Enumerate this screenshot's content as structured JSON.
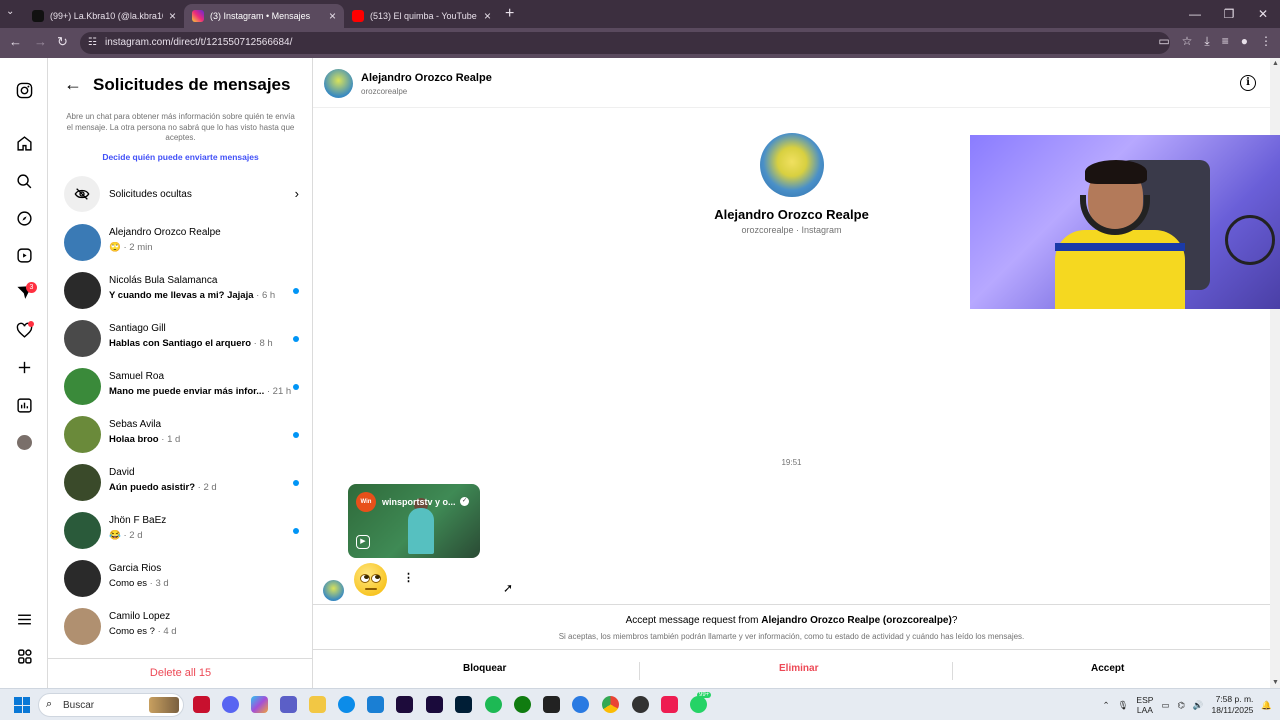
{
  "browser": {
    "tabs": [
      {
        "title": "(99+) La.Kbra10 (@la.kbra10) | T",
        "icon_color": "#111111"
      },
      {
        "title": "(3) Instagram • Mensajes",
        "icon_color": "#e1306c"
      },
      {
        "title": "(513) El quimba - YouTube",
        "icon_color": "#ff0000"
      }
    ],
    "url": "instagram.com/direct/t/121550712566684/"
  },
  "nav": {
    "messages_badge": "3"
  },
  "requests": {
    "title": "Solicitudes de mensajes",
    "info": "Abre un chat para obtener más información sobre quién te envía el mensaje. La otra persona no sabrá que lo has visto hasta que aceptes.",
    "link": "Decide quién puede enviarte mensajes",
    "hidden_label": "Solicitudes ocultas",
    "threads": [
      {
        "name": "Alejandro Orozco Realpe",
        "message": "🙄",
        "time": " · 2 min",
        "unread": false,
        "color": "#3a7ab5"
      },
      {
        "name": "Nicolás Bula Salamanca",
        "message": "Y cuando me llevas a mi? Jajaja",
        "time": " · 6 h",
        "unread": true,
        "color": "#2a2a2a"
      },
      {
        "name": "Santiago Gill",
        "message": "Hablas con Santiago el arquero",
        "time": " · 8 h",
        "unread": true,
        "color": "#4a4a4a"
      },
      {
        "name": "Samuel Roa",
        "message": "Mano me puede enviar más infor...",
        "time": " · 21 h",
        "unread": true,
        "color": "#3a8a3a"
      },
      {
        "name": "Sebas Avila",
        "message": "Holaa broo",
        "time": " · 1 d",
        "unread": true,
        "color": "#6a8a3a"
      },
      {
        "name": "David",
        "message": "Aún puedo asistir?",
        "time": " · 2 d",
        "unread": true,
        "color": "#3a4a2a"
      },
      {
        "name": "Jhön F BaEz",
        "message": "😂",
        "time": " · 2 d",
        "unread": true,
        "color": "#2a5a3a"
      },
      {
        "name": "Garcia Rios",
        "message": "Como es",
        "time": " · 3 d",
        "unread": false,
        "color": "#2a2a2a"
      },
      {
        "name": "Camilo Lopez",
        "message": "Como es ?",
        "time": " · 4 d",
        "unread": false,
        "color": "#b09070"
      }
    ],
    "delete_all": "Delete all 15"
  },
  "chat": {
    "header_name": "Alejandro Orozco Realpe",
    "header_username": "orozcorealpe",
    "profile_name": "Alejandro Orozco Realpe",
    "profile_sub": "orozcorealpe · Instagram",
    "timestamp": "19:51",
    "reel_account": "winsportstv y o...",
    "reel_logo": "Win",
    "accept_prefix": "Accept message request from ",
    "accept_name": "Alejandro Orozco Realpe (orozcorealpe)",
    "accept_suffix": "?",
    "accept_note": "Si aceptas, los miembros también podrán llamarte y ver información, como tu estado de actividad y cuándo has leído los mensajes.",
    "block_label": "Bloquear",
    "delete_label": "Eliminar",
    "accept_label": "Accept"
  },
  "taskbar": {
    "search_placeholder": "Buscar",
    "lang_top": "ESP",
    "lang_bottom": "LAA",
    "time": "7:58 p. m.",
    "date": "18/11/2025",
    "whatsapp_badge": "99+"
  }
}
